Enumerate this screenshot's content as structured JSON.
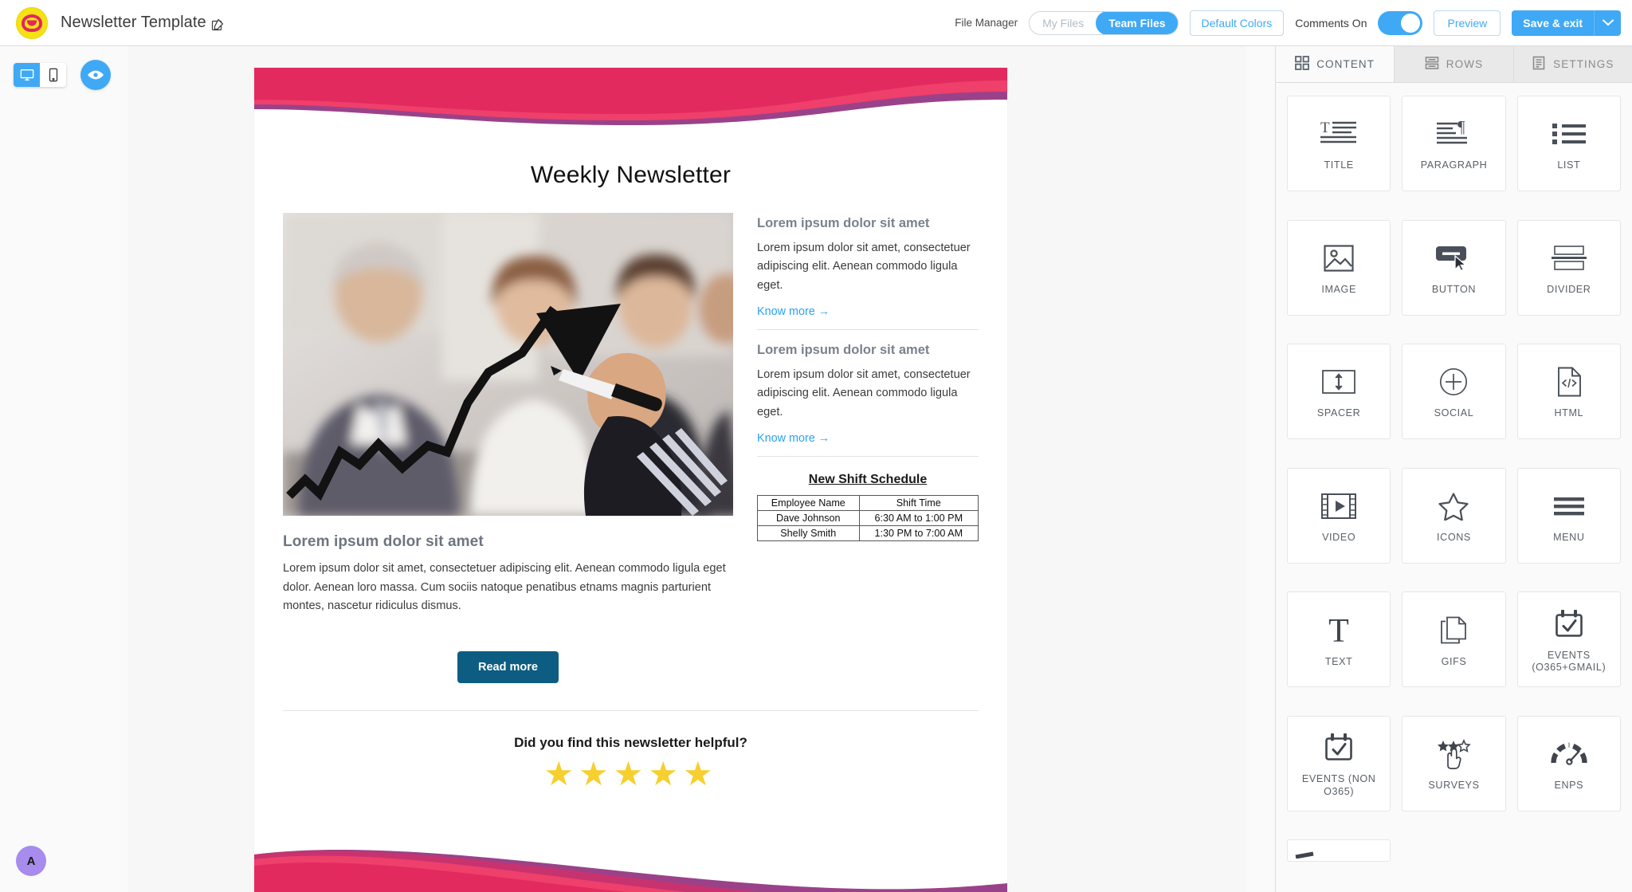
{
  "topbar": {
    "brand_title": "Newsletter Template",
    "edit_icon": "pencil-icon",
    "file_manager_label": "File Manager",
    "segmented": {
      "option_my_files": "My Files",
      "option_team_files": "Team Files",
      "selected": "Team Files"
    },
    "default_colors_label": "Default Colors",
    "comments_label": "Comments On",
    "comments_toggle_state": "on",
    "preview_label": "Preview",
    "save_label": "Save & exit",
    "save_caret_icon": "chevron-down-icon",
    "accent_blue": "#3fa9f5"
  },
  "left_toolbar": {
    "desktop_icon": "desktop-monitor-icon",
    "mobile_icon": "mobile-phone-icon",
    "preview_eye_icon": "eye-icon",
    "active_device": "desktop",
    "avatar_initial": "A",
    "avatar_color": "#a78bed"
  },
  "email": {
    "title": "Weekly Newsletter",
    "hero_image_alt": "business-meeting-growth-arrow-photo",
    "left_column": {
      "heading": "Lorem ipsum dolor sit amet",
      "body": "Lorem ipsum dolor sit amet, consectetuer adipiscing elit. Aenean commodo ligula eget dolor. Aenean loro massa. Cum sociis natoque penatibus etnams magnis parturient montes, nascetur ridiculus dismus.",
      "button_label": "Read more",
      "button_color": "#0d5d82"
    },
    "right_column": {
      "blocks": [
        {
          "heading": "Lorem ipsum dolor sit amet",
          "body": "Lorem ipsum dolor sit amet, consectetuer adipiscing elit. Aenean commodo ligula eget.",
          "link": "Know more  →"
        },
        {
          "heading": "Lorem ipsum dolor sit amet",
          "body": "Lorem ipsum dolor sit amet, consectetuer adipiscing elit. Aenean commodo ligula eget.",
          "link": "Know more  →"
        }
      ],
      "schedule": {
        "title": "New Shift Schedule",
        "headers": [
          "Employee Name",
          "Shift Time"
        ],
        "rows": [
          [
            "Dave Johnson",
            "6:30 AM to 1:00 PM"
          ],
          [
            "Shelly Smith",
            "1:30 PM to 7:00 AM"
          ]
        ]
      }
    },
    "survey": {
      "question": "Did you find this newsletter helpful?",
      "stars": "★★★★★",
      "star_count": 5,
      "star_color": "#f7cf2e"
    },
    "wave_colors": {
      "pink": "#e32a5e",
      "magenta": "#c7336f",
      "purple": "#9a4289",
      "rose": "#ef3f6b"
    }
  },
  "right_panel": {
    "tabs": [
      {
        "label": "CONTENT",
        "icon": "grid-squares-icon",
        "active": true
      },
      {
        "label": "ROWS",
        "icon": "rows-stack-icon",
        "active": false
      },
      {
        "label": "SETTINGS",
        "icon": "document-lines-icon",
        "active": false
      }
    ],
    "blocks": [
      {
        "label": "TITLE",
        "icon": "title-text-icon"
      },
      {
        "label": "PARAGRAPH",
        "icon": "paragraph-icon"
      },
      {
        "label": "LIST",
        "icon": "bullet-list-icon"
      },
      {
        "label": "IMAGE",
        "icon": "image-picture-icon"
      },
      {
        "label": "BUTTON",
        "icon": "button-cursor-icon"
      },
      {
        "label": "DIVIDER",
        "icon": "divider-icon"
      },
      {
        "label": "SPACER",
        "icon": "spacer-vertical-arrow-icon"
      },
      {
        "label": "SOCIAL",
        "icon": "plus-circle-icon"
      },
      {
        "label": "HTML",
        "icon": "code-file-icon"
      },
      {
        "label": "VIDEO",
        "icon": "video-film-play-icon"
      },
      {
        "label": "ICONS",
        "icon": "star-outline-icon"
      },
      {
        "label": "MENU",
        "icon": "hamburger-menu-icon"
      },
      {
        "label": "TEXT",
        "icon": "serif-t-icon"
      },
      {
        "label": "GIFS",
        "icon": "copy-pages-icon"
      },
      {
        "label": "EVENTS (O365+GMAIL)",
        "icon": "calendar-check-icon"
      },
      {
        "label": "EVENTS (NON O365)",
        "icon": "calendar-check-icon"
      },
      {
        "label": "SURVEYS",
        "icon": "stars-hand-click-icon"
      },
      {
        "label": "ENPS",
        "icon": "gauge-meter-icon"
      }
    ]
  }
}
